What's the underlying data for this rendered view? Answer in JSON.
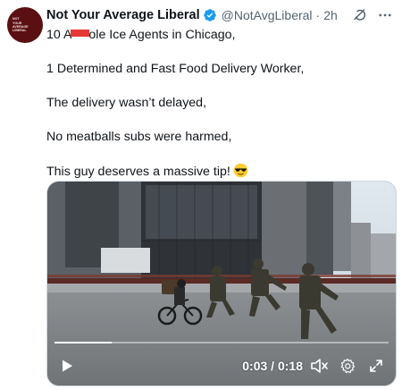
{
  "author": {
    "name": "Not Your Average Liberal",
    "handle": "@NotAvgLiberal",
    "time": "2h",
    "avatar_text": [
      "NOT",
      "YOUR",
      "AVERAGE",
      "LIBERAL"
    ],
    "avatar_color": "#5a0f12"
  },
  "verified_color": "#1d9bf0",
  "header_icons": [
    "grok-icon",
    "more-options-icon"
  ],
  "tweet": {
    "line1_pre": "10 A",
    "line1_post": "ole Ice Agents in Chicago,",
    "line2": "1 Determined and Fast Food Delivery Worker,",
    "line3": "The delivery wasn’t delayed,",
    "line4": "No meatballs subs were harmed,",
    "line5": "This guy deserves a massive tip!",
    "emoji": "sunglasses-emoji",
    "redaction_color": "#e53935"
  },
  "video": {
    "current_time": "0:03",
    "separator": " / ",
    "duration": "0:18",
    "progress": 0.17,
    "controls": [
      "play-icon",
      "volume-muted-icon",
      "settings-gear-icon",
      "fullscreen-icon"
    ]
  }
}
